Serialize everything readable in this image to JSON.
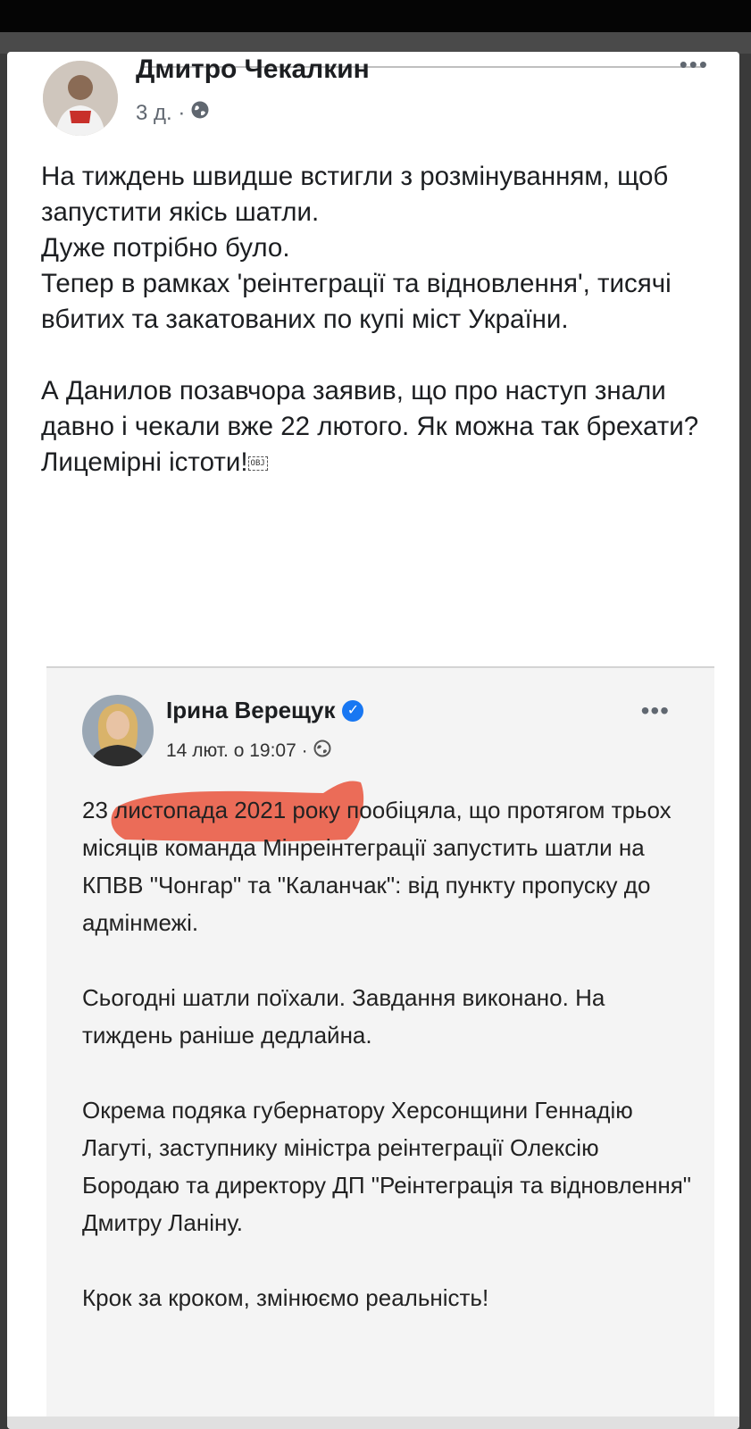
{
  "post": {
    "author": "Дмитро Чекалкин",
    "time": "3 д. ·",
    "more_label": "•••",
    "paragraphs": [
      "На тиждень швидше встигли з розмінуванням, щоб запустити якісь шатли.",
      "Дуже потрібно було.",
      "Тепер в рамках 'реінтеграції та відновлення', тисячі вбитих та закатованих по купі міст України.",
      "",
      "А Данилов позавчора заявив, що про наступ знали давно і чекали вже 22 лютого. Як можна так брехати? Лицемірні істоти!"
    ],
    "obj_glyph": "OBJ"
  },
  "embedded_post": {
    "author": "Ірина Верещук",
    "verified_mark": "✓",
    "time": "14 лют. о 19:07 ·",
    "more_label": "•••",
    "paragraphs": [
      "23 листопада 2021 року пообіцяла, що протягом трьох місяців команда Мінреінтеграції запустить шатли на КПВВ \"Чонгар\" та \"Каланчак\": від пункту пропуску до адмінмежі.",
      "",
      "Сьогодні шатли поїхали. Завдання виконано. На тиждень раніше дедлайна.",
      "",
      "Окрема подяка губернатору Херсонщини Геннадію Лагуті, заступнику міністра реінтеграції Олексію Бородаю та директору ДП \"Реінтеграція та відновлення\" Дмитру Ланіну.",
      "",
      "Крок за кроком, змінюємо реальність!"
    ]
  },
  "colors": {
    "highlight": "#e8452c",
    "verified": "#1877f2"
  }
}
